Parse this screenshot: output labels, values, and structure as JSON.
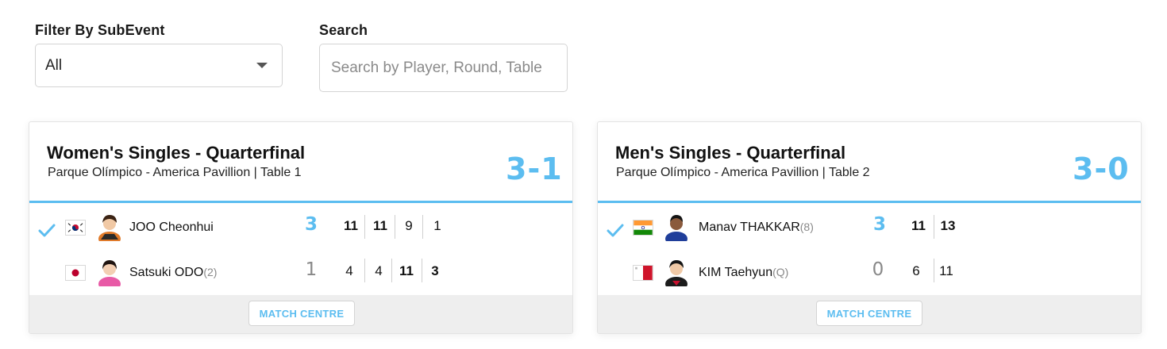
{
  "filters": {
    "subevent_label": "Filter By SubEvent",
    "subevent_value": "All",
    "search_label": "Search",
    "search_placeholder": "Search by Player, Round, Table"
  },
  "matches": [
    {
      "title": "Women's Singles - Quarterfinal",
      "venue": "Parque Olímpico - America Pavillion | Table 1",
      "score": "3-1",
      "players": [
        {
          "name": "JOO Cheonhui",
          "seed": "",
          "flag": "south-korea-flag",
          "winner": true,
          "total": "3",
          "games": [
            "11",
            "11",
            "9",
            "1"
          ]
        },
        {
          "name": "Satsuki ODO",
          "seed": "(2)",
          "flag": "japan-flag",
          "winner": false,
          "total": "1",
          "games": [
            "4",
            "4",
            "11",
            "3"
          ]
        }
      ],
      "match_centre_label": "MATCH CENTRE"
    },
    {
      "title": "Men's Singles - Quarterfinal",
      "venue": "Parque Olímpico - America Pavillion | Table 2",
      "score": "3-0",
      "players": [
        {
          "name": "Manav THAKKAR",
          "seed": "(8)",
          "flag": "india-flag",
          "winner": true,
          "total": "3",
          "games": [
            "11",
            "13"
          ]
        },
        {
          "name": "KIM Taehyun",
          "seed": "(Q)",
          "flag": "malta-flag",
          "winner": false,
          "total": "0",
          "games": [
            "6",
            "11"
          ]
        }
      ],
      "match_centre_label": "MATCH CENTRE"
    }
  ],
  "colors": {
    "accent": "#5cbdf0",
    "footer_bg": "#eeeeee"
  }
}
